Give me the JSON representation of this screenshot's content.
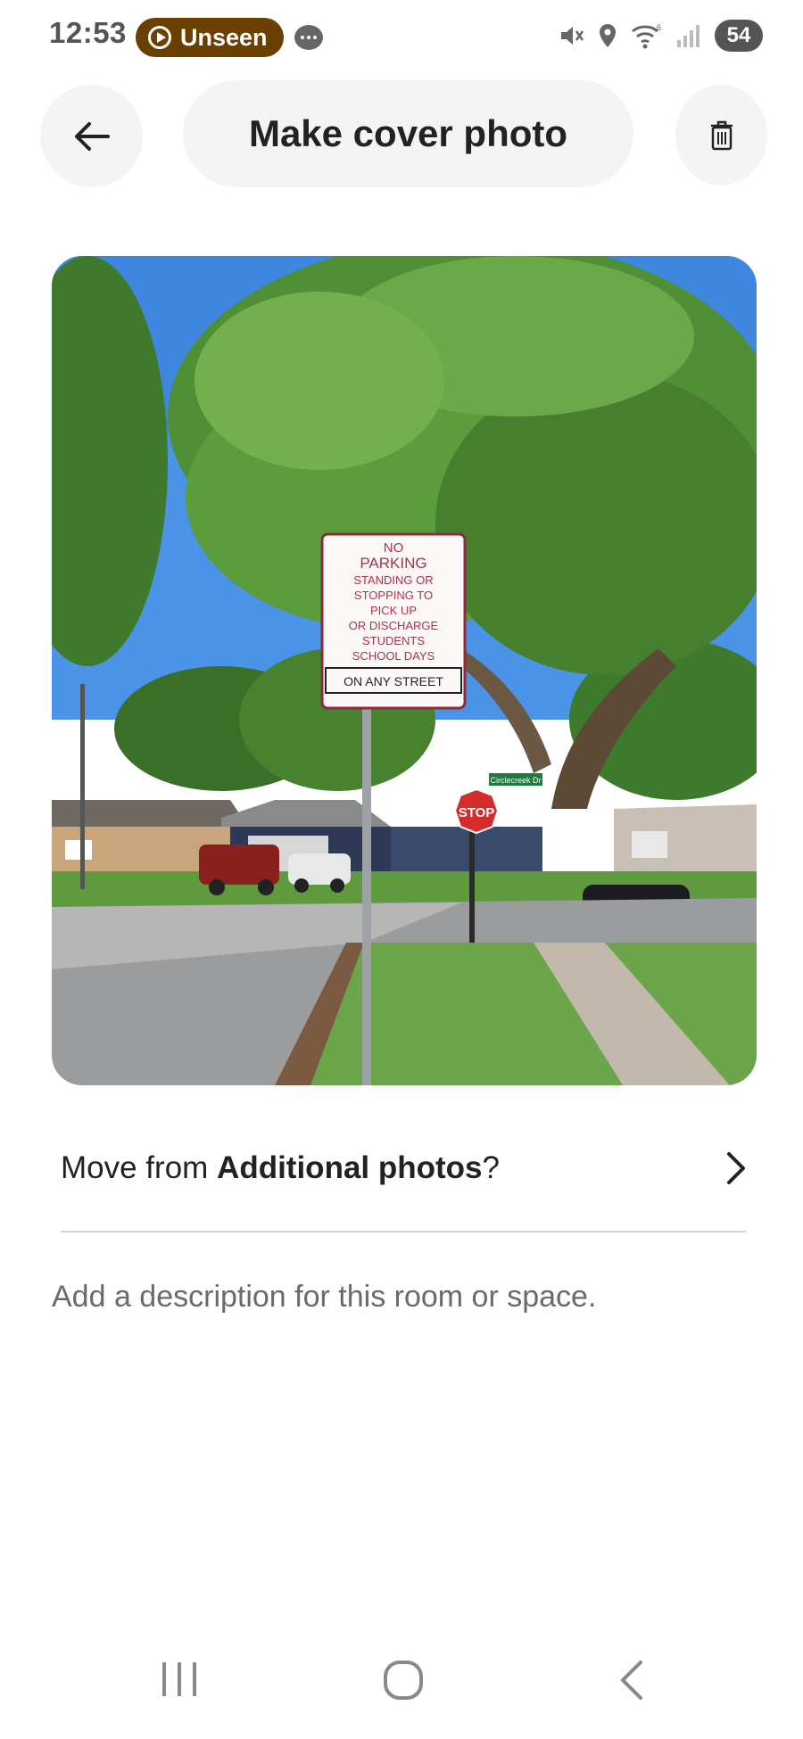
{
  "status_bar": {
    "time": "12:53",
    "unseen_label": "Unseen",
    "battery": "54",
    "icons": [
      "play-circle-icon",
      "chat-bubble-icon",
      "mute-icon",
      "location-icon",
      "wifi-icon",
      "signal-icon",
      "battery-icon"
    ]
  },
  "header": {
    "title": "Make cover photo",
    "back_icon": "arrow-left-icon",
    "delete_icon": "trash-icon"
  },
  "photo": {
    "sign_lines": [
      "NO",
      "PARKING",
      "STANDING OR",
      "STOPPING TO",
      "PICK UP",
      "OR DISCHARGE",
      "STUDENTS",
      "SCHOOL DAYS"
    ],
    "sign_bottom": "ON ANY STREET",
    "stop_sign": "STOP",
    "street_sign": "Circlecreek Dr"
  },
  "move_row": {
    "prefix": "Move from ",
    "emphasis": "Additional photos",
    "suffix": "?",
    "icon": "chevron-right-icon"
  },
  "description_placeholder": "Add a description for this room or space.",
  "nav_bar": {
    "icons": [
      "recent-apps-icon",
      "home-icon",
      "back-icon"
    ]
  },
  "colors": {
    "accent_badge": "#6b3f00",
    "pill_bg": "#f4f4f4",
    "text_primary": "#222222",
    "text_secondary": "#6a6a6a"
  }
}
